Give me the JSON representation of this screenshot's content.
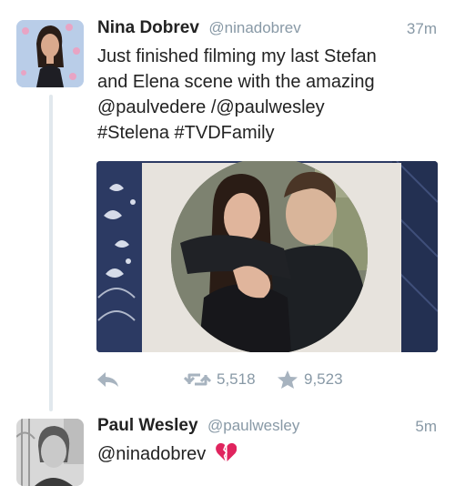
{
  "colors": {
    "text": "#222222",
    "secondary": "#8899a6",
    "icon": "#a7b3bf",
    "thread_line": "#e1e8ed",
    "heart": "#e0245e"
  },
  "tweets": [
    {
      "display_name": "Nina Dobrev",
      "handle": "@ninadobrev",
      "time": "37m",
      "text_lines": [
        "Just finished filming my last Stefan",
        "and Elena scene with the amazing",
        "@paulvedere /@paulwesley",
        "#Stelena #TVDFamily"
      ],
      "has_photo": true,
      "retweets": "5,518",
      "favorites": "9,523",
      "icons": {
        "reply": "reply-icon",
        "retweet": "retweet-icon",
        "favorite": "star-icon"
      }
    },
    {
      "display_name": "Paul Wesley",
      "handle": "@paulwesley",
      "time": "5m",
      "text": "@ninadobrev",
      "emoji": "broken-heart"
    }
  ]
}
